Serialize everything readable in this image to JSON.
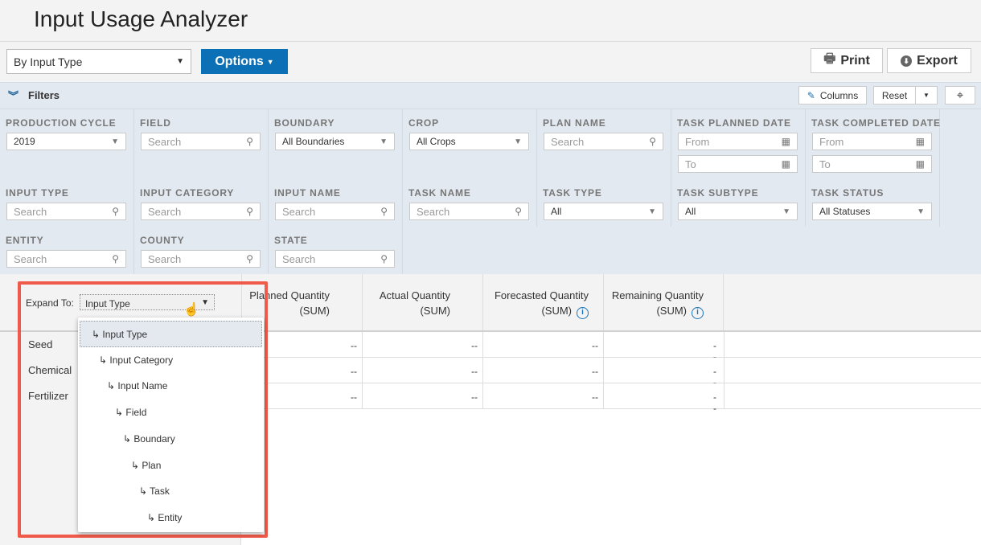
{
  "app": {
    "title": "Input Usage Analyzer"
  },
  "toolbar": {
    "view_select": "By Input Type",
    "options_label": "Options",
    "print_label": "Print",
    "export_label": "Export"
  },
  "filterbar": {
    "label": "Filters",
    "columns_label": "Columns",
    "reset_label": "Reset"
  },
  "filters": [
    {
      "label": "PRODUCTION CYCLE",
      "value": "2019",
      "kind": "select"
    },
    {
      "label": "FIELD",
      "placeholder": "Search",
      "kind": "search"
    },
    {
      "label": "BOUNDARY",
      "value": "All Boundaries",
      "kind": "select"
    },
    {
      "label": "CROP",
      "value": "All Crops",
      "kind": "select"
    },
    {
      "label": "PLAN NAME",
      "placeholder": "Search",
      "kind": "search"
    },
    {
      "label": "TASK PLANNED DATE",
      "from": "From",
      "to": "To",
      "kind": "date"
    },
    {
      "label": "TASK COMPLETED DATE",
      "from": "From",
      "to": "To",
      "kind": "date"
    },
    {
      "label": "INPUT TYPE",
      "placeholder": "Search",
      "kind": "search"
    },
    {
      "label": "INPUT CATEGORY",
      "placeholder": "Search",
      "kind": "search"
    },
    {
      "label": "INPUT NAME",
      "placeholder": "Search",
      "kind": "search"
    },
    {
      "label": "TASK NAME",
      "placeholder": "Search",
      "kind": "search"
    },
    {
      "label": "TASK TYPE",
      "value": "All",
      "kind": "select"
    },
    {
      "label": "TASK SUBTYPE",
      "value": "All",
      "kind": "select"
    },
    {
      "label": "TASK STATUS",
      "value": "All Statuses",
      "kind": "select"
    },
    {
      "label": "ENTITY",
      "placeholder": "Search",
      "kind": "search"
    },
    {
      "label": "COUNTY",
      "placeholder": "Search",
      "kind": "search"
    },
    {
      "label": "STATE",
      "placeholder": "Search",
      "kind": "search"
    }
  ],
  "table": {
    "expand_label": "Expand To:",
    "expand_value": "Input Type",
    "columns": [
      {
        "line1": "Planned Quantity",
        "line2": "(SUM)",
        "info": false
      },
      {
        "line1": "Actual Quantity",
        "line2": "(SUM)",
        "info": false
      },
      {
        "line1": "Forecasted Quantity",
        "line2": "(SUM)",
        "info": true
      },
      {
        "line1": "Remaining Quantity",
        "line2": "(SUM)",
        "info": true
      }
    ],
    "rows": [
      {
        "label": "Seed",
        "values": [
          "--",
          "--",
          "--",
          "--"
        ]
      },
      {
        "label": "Chemical",
        "values": [
          "--",
          "--",
          "--",
          "--"
        ]
      },
      {
        "label": "Fertilizer",
        "values": [
          "--",
          "--",
          "--",
          "--"
        ]
      }
    ]
  },
  "dropdown": {
    "items": [
      "Input Type",
      "Input Category",
      "Input Name",
      "Field",
      "Boundary",
      "Plan",
      "Task",
      "Entity"
    ],
    "selected": "Input Type"
  },
  "colors": {
    "accent": "#0b70b5",
    "highlight": "#f05a4a"
  }
}
